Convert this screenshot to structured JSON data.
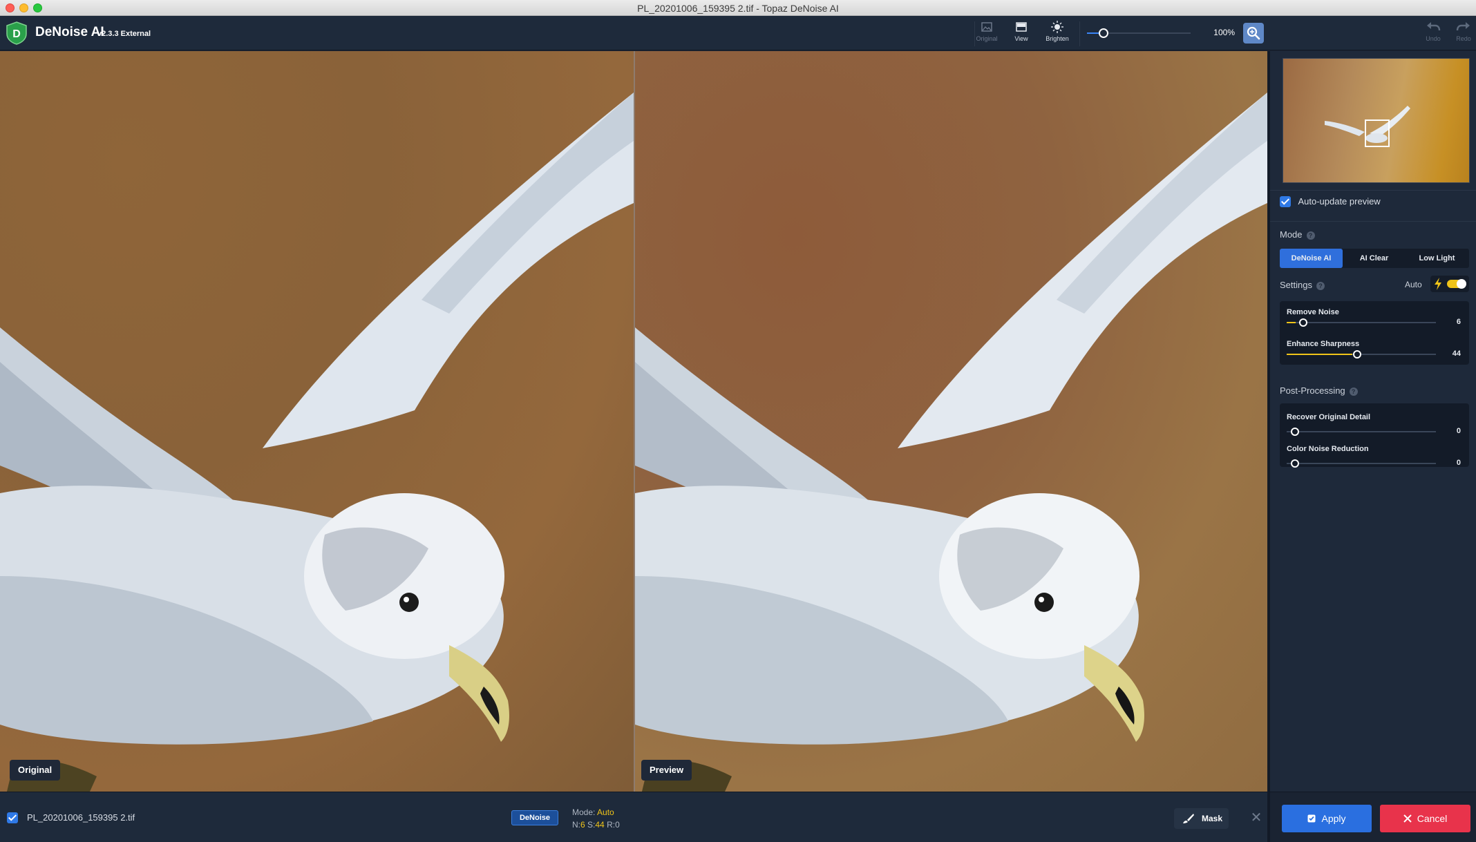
{
  "window": {
    "title": "PL_20201006_159395 2.tif - Topaz DeNoise AI"
  },
  "app": {
    "name": "DeNoise AI",
    "version": "v2.3.3 External",
    "logo_letter": "D"
  },
  "toolbar": {
    "original_label": "Original",
    "view_label": "View",
    "brighten_label": "Brighten",
    "zoom_value": "100%",
    "zoom_level": 0.16,
    "undo_label": "Undo",
    "redo_label": "Redo"
  },
  "panes": {
    "left_label": "Original",
    "right_label": "Preview"
  },
  "panel": {
    "auto_update_label": "Auto-update preview",
    "mode_title": "Mode",
    "modes": [
      "DeNoise AI",
      "AI Clear",
      "Low Light"
    ],
    "active_mode": "DeNoise AI",
    "settings_title": "Settings",
    "auto_label": "Auto",
    "settings_sliders": [
      {
        "name": "Remove Noise",
        "value": "6",
        "level": 0.06
      },
      {
        "name": "Enhance Sharpness",
        "value": "44",
        "level": 0.44
      }
    ],
    "postprocessing_title": "Post-Processing",
    "post_sliders": [
      {
        "name": "Recover Original Detail",
        "value": "0",
        "level": 0.0
      },
      {
        "name": "Color Noise Reduction",
        "value": "0",
        "level": 0.0
      }
    ]
  },
  "bottom": {
    "file_name": "PL_20201006_159395 2.tif",
    "model_badge": "DeNoise",
    "mode_prefix": "Mode:",
    "mode_value": "Auto",
    "n_label": "N:",
    "n_value": "6",
    "s_label": "S:",
    "s_value": "44",
    "r_label": "R:",
    "r_value": "0",
    "mask_label": "Mask",
    "close_glyph": "✕"
  },
  "actions": {
    "apply_label": "Apply",
    "cancel_label": "Cancel"
  },
  "colors": {
    "accent": "#2f6fdc",
    "slider_accent": "#f0c419",
    "cancel": "#e8334b",
    "panel_bg": "#1e293a"
  }
}
